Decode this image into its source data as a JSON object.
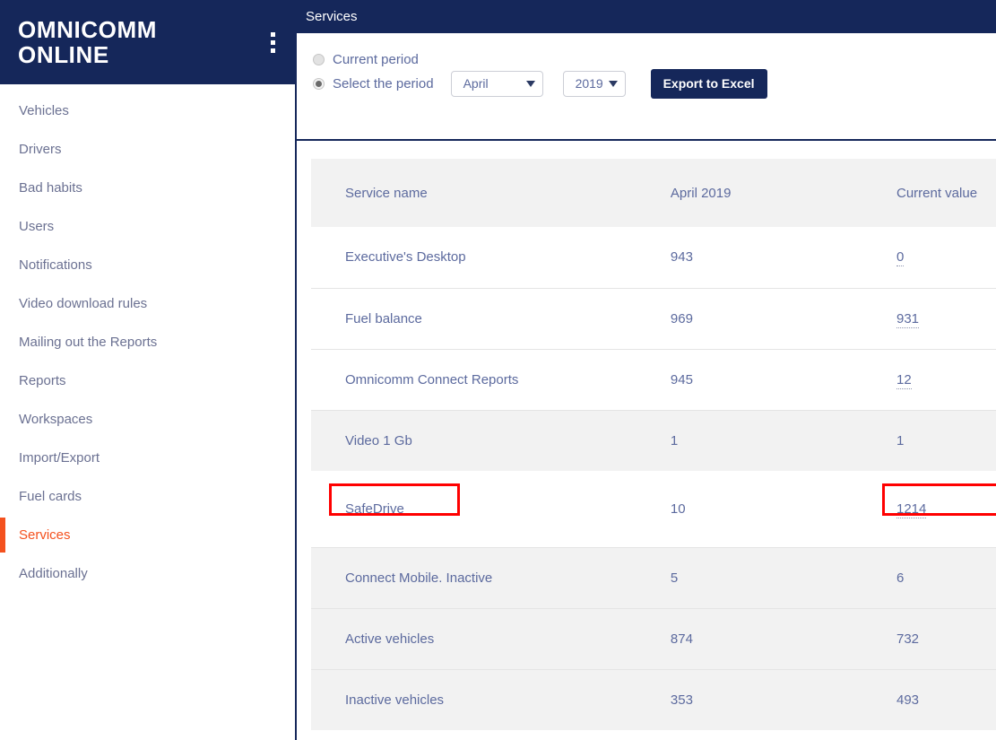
{
  "brand": {
    "name": "OMNICOMM\nONLINE",
    "menu_icon": "kebab-menu-icon"
  },
  "sidebar": {
    "items": [
      {
        "label": "Vehicles",
        "active": false
      },
      {
        "label": "Drivers",
        "active": false
      },
      {
        "label": "Bad habits",
        "active": false
      },
      {
        "label": "Users",
        "active": false
      },
      {
        "label": "Notifications",
        "active": false
      },
      {
        "label": "Video download rules",
        "active": false
      },
      {
        "label": "Mailing out the Reports",
        "active": false
      },
      {
        "label": "Reports",
        "active": false
      },
      {
        "label": "Workspaces",
        "active": false
      },
      {
        "label": "Import/Export",
        "active": false
      },
      {
        "label": "Fuel cards",
        "active": false
      },
      {
        "label": "Services",
        "active": true
      },
      {
        "label": "Additionally",
        "active": false
      }
    ]
  },
  "topbar": {
    "title": "Services"
  },
  "filters": {
    "current_period_label": "Current period",
    "current_period_selected": false,
    "select_period_label": "Select the period",
    "select_period_selected": true,
    "month_value": "April",
    "year_value": "2019",
    "export_label": "Export to Excel"
  },
  "table": {
    "columns": [
      "Service name",
      "April 2019",
      "Current value"
    ],
    "rows": [
      {
        "name": "Executive's Desktop",
        "previous": "943",
        "current": "0",
        "shaded": false,
        "dotted": true,
        "highlight": false
      },
      {
        "name": "Fuel balance",
        "previous": "969",
        "current": "931",
        "shaded": false,
        "dotted": true,
        "highlight": false
      },
      {
        "name": "Omnicomm Connect Reports",
        "previous": "945",
        "current": "12",
        "shaded": false,
        "dotted": true,
        "highlight": false
      },
      {
        "name": "Video 1 Gb",
        "previous": "1",
        "current": "1",
        "shaded": true,
        "dotted": false,
        "highlight": false
      },
      {
        "name": "SafeDrive",
        "previous": "10",
        "current": "1214",
        "shaded": false,
        "dotted": true,
        "highlight": true
      },
      {
        "name": "Connect Mobile. Inactive",
        "previous": "5",
        "current": "6",
        "shaded": true,
        "dotted": false,
        "highlight": false
      },
      {
        "name": "Active vehicles",
        "previous": "874",
        "current": "732",
        "shaded": true,
        "dotted": false,
        "highlight": false
      },
      {
        "name": "Inactive vehicles",
        "previous": "353",
        "current": "493",
        "shaded": true,
        "dotted": false,
        "highlight": false
      }
    ]
  },
  "colors": {
    "brand_navy": "#15275a",
    "accent_orange": "#f4511e",
    "text_blue_gray": "#5c6a9e",
    "row_shade": "#f2f2f2",
    "annotation_red": "#ff0000"
  }
}
